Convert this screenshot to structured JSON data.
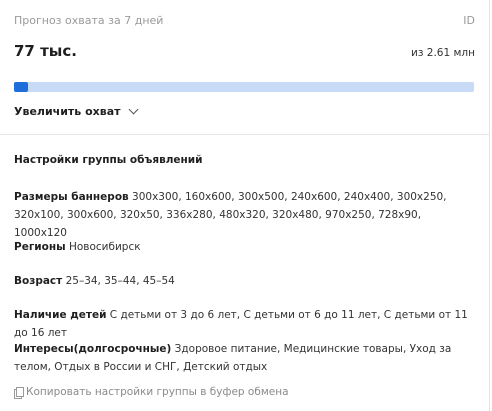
{
  "header": {
    "title": "Прогноз охвата за 7 дней",
    "id_label": "ID"
  },
  "reach": {
    "value": "77 тыс.",
    "total": "из 2.61 млн",
    "progress_fraction": 0.0295
  },
  "increase": {
    "label": "Увеличить охват"
  },
  "settings": {
    "title": "Настройки группы объявлений",
    "banners": {
      "label": "Размеры баннеров",
      "value": "300x300, 160x600, 300x500, 240x600, 240x400, 300x250, 320x100, 300x600, 320x50, 336x280, 480x320, 320x480, 970x250, 728x90, 1000x120"
    },
    "regions": {
      "label": "Регионы",
      "value": "Новосибирск"
    },
    "age": {
      "label": "Возраст",
      "value": "25–34, 35–44, 45–54"
    },
    "children": {
      "label": "Наличие детей",
      "value": "С детьми от 3 до 6 лет, С детьми от 6 до 11 лет, С детьми от 11 до 16 лет"
    },
    "interests": {
      "label": "Интересы(долгосрочные)",
      "value": "Здоровое питание, Медицинские товары, Уход за телом, Отдых в России и СНГ, Детский отдых"
    }
  },
  "copy": {
    "label": "Копировать настройки группы в буфер обмена"
  },
  "icons": {
    "chevron": "chevron-down-icon",
    "copy": "copy-icon"
  },
  "colors": {
    "progress_fill": "#1e6fd9",
    "progress_track": "#c8dbf6"
  }
}
